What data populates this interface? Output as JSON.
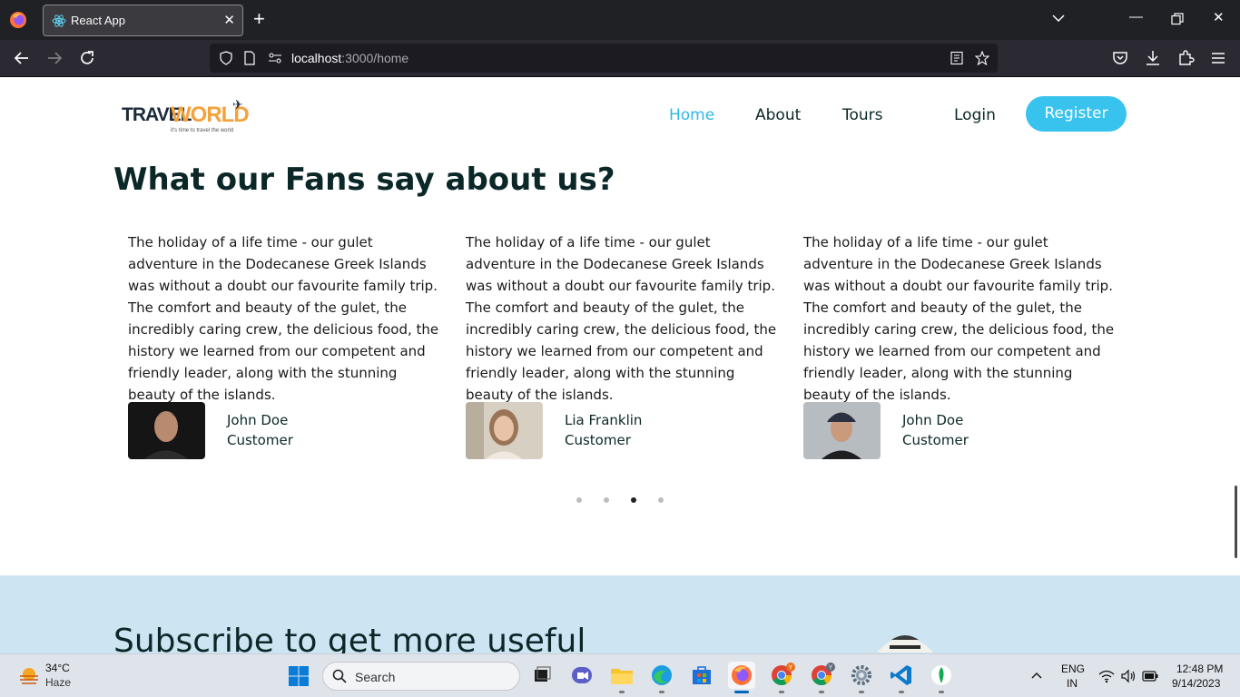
{
  "browser": {
    "tab_title": "React App",
    "url_host": "localhost",
    "url_path": ":3000/home"
  },
  "site": {
    "logo_travel": "TRAVEL",
    "logo_world": "WORLD",
    "logo_tagline": "it's time to travel the world",
    "nav": [
      "Home",
      "About",
      "Tours"
    ],
    "login": "Login",
    "register": "Register"
  },
  "testimonials": {
    "title": "What our Fans say about us?",
    "items": [
      {
        "text": "The holiday of a life time - our gulet adventure in the Dodecanese Greek Islands was without a doubt our favourite family trip. The comfort and beauty of the gulet, the incredibly caring crew, the delicious food, the history we learned from our competent and friendly leader, along with the stunning beauty of the islands.",
        "name": "John Doe",
        "role": "Customer"
      },
      {
        "text": "The holiday of a life time - our gulet adventure in the Dodecanese Greek Islands was without a doubt our favourite family trip. The comfort and beauty of the gulet, the incredibly caring crew, the delicious food, the history we learned from our competent and friendly leader, along with the stunning beauty of the islands.",
        "name": "Lia Franklin",
        "role": "Customer"
      },
      {
        "text": "The holiday of a life time - our gulet adventure in the Dodecanese Greek Islands was without a doubt our favourite family trip. The comfort and beauty of the gulet, the incredibly caring crew, the delicious food, the history we learned from our competent and friendly leader, along with the stunning beauty of the islands.",
        "name": "John Doe",
        "role": "Customer"
      }
    ],
    "active_dot": 3,
    "dot_count": 4
  },
  "subscribe": {
    "title": "Subscribe to get more useful"
  },
  "taskbar": {
    "temperature": "34°C",
    "weather": "Haze",
    "search_placeholder": "Search",
    "lang_primary": "ENG",
    "lang_region": "IN",
    "time": "12:48 PM",
    "date": "9/14/2023",
    "badge_1": "Y",
    "badge_2": "Y"
  },
  "colors": {
    "accent": "#2fb7e6",
    "register_bg": "#38c3ee",
    "heading": "#0b2727",
    "subscribe_bg": "#cde5f3",
    "logo_orange": "#f3a23c"
  }
}
